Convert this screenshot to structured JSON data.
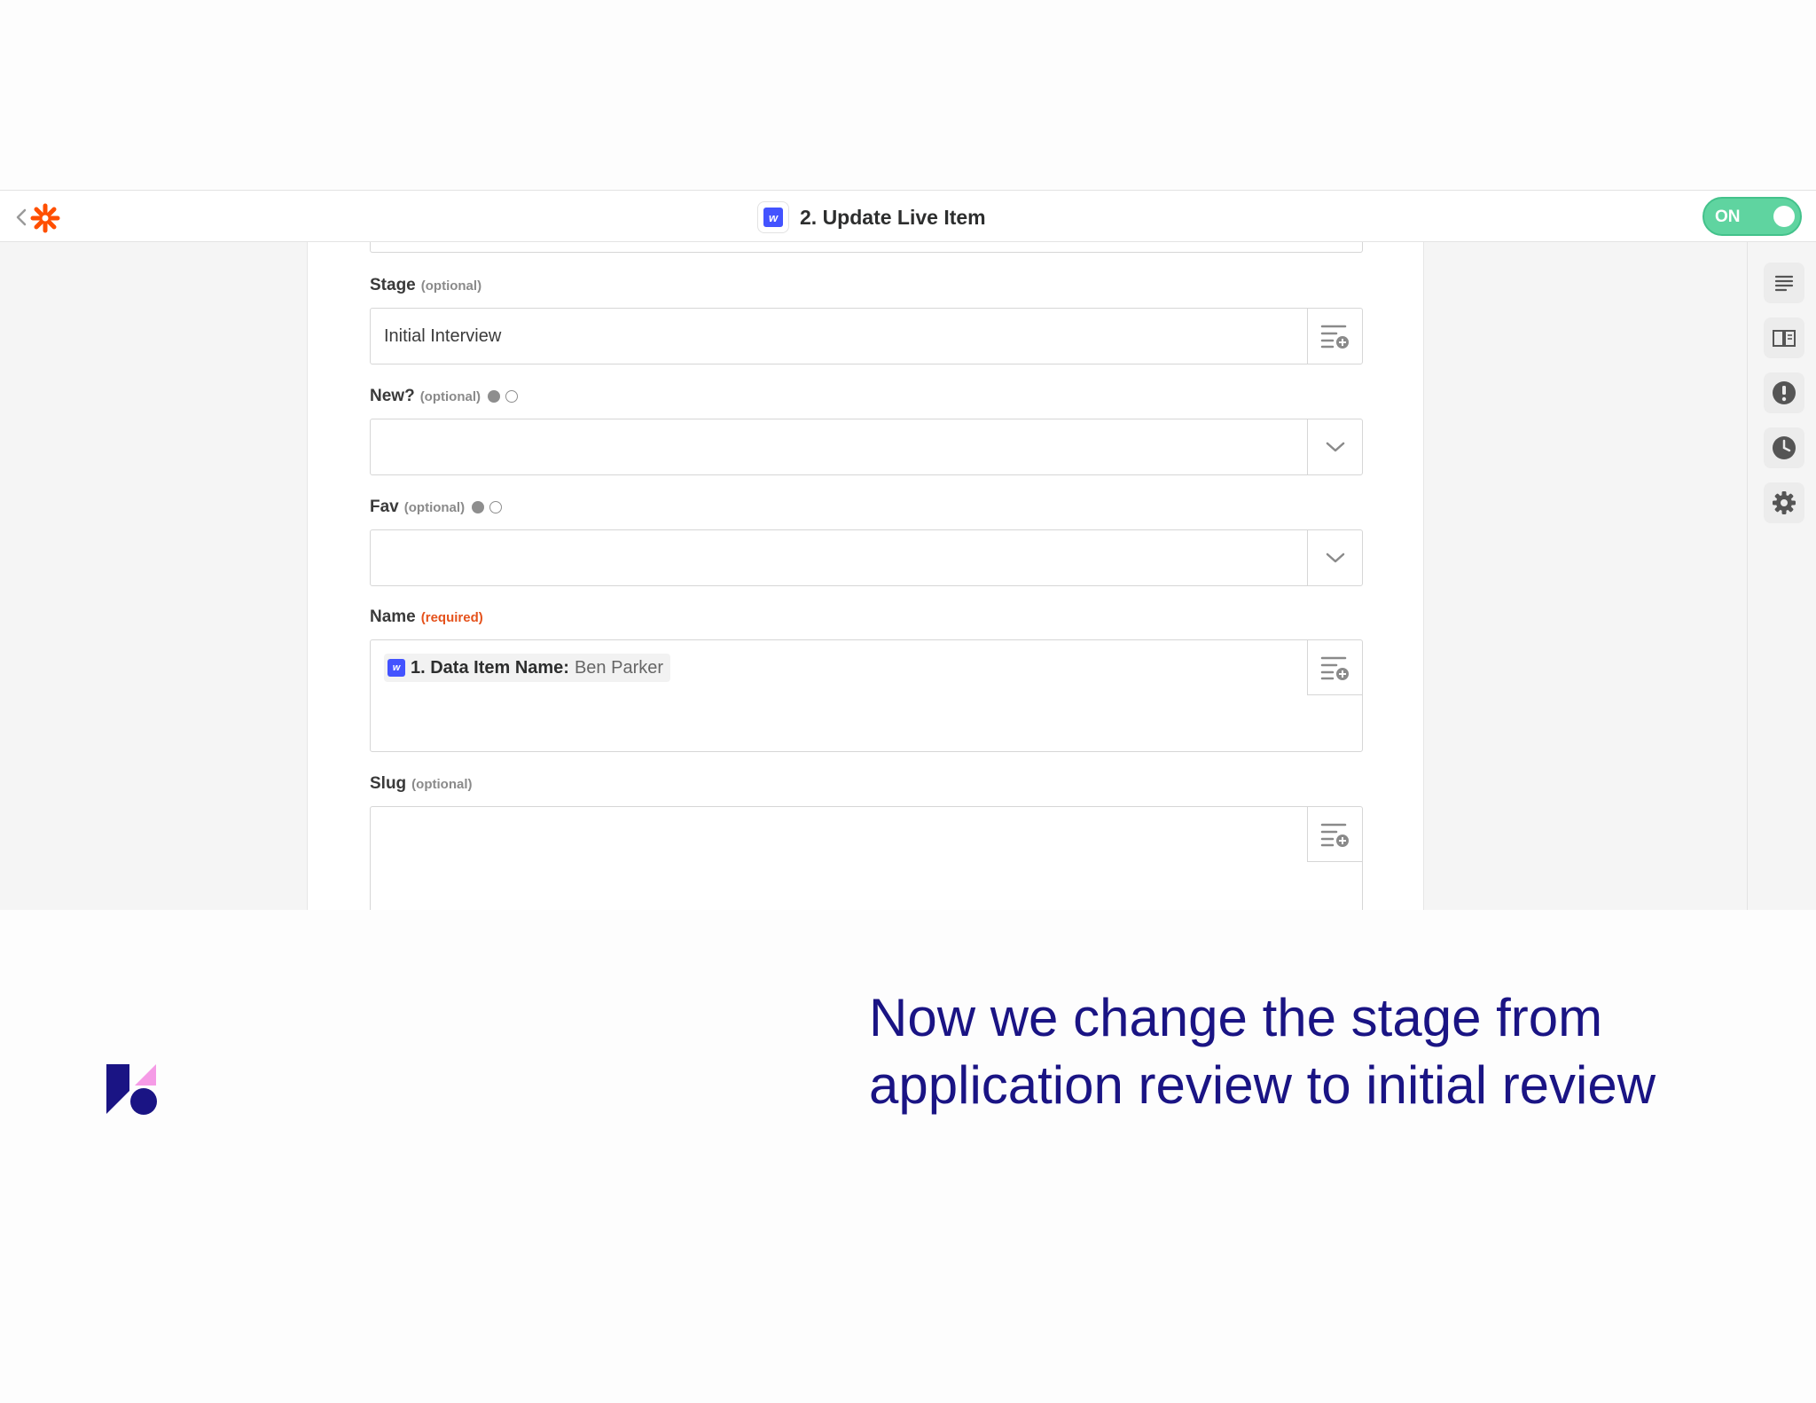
{
  "header": {
    "title": "2. Update Live Item",
    "app_badge_letter": "w",
    "toggle_label": "ON"
  },
  "form": {
    "stage": {
      "label": "Stage",
      "qualifier": "(optional)",
      "value": "Initial Interview"
    },
    "new": {
      "label": "New?",
      "qualifier": "(optional)",
      "value": ""
    },
    "fav": {
      "label": "Fav",
      "qualifier": "(optional)",
      "value": ""
    },
    "name": {
      "label": "Name",
      "qualifier": "(required)",
      "token_badge_letter": "w",
      "token_key": "1. Data Item Name:",
      "token_value": "Ben Parker"
    },
    "slug": {
      "label": "Slug",
      "qualifier": "(optional)",
      "value": ""
    }
  },
  "right_rail": [
    "list-icon",
    "book-icon",
    "alert-icon",
    "clock-icon",
    "gear-icon"
  ],
  "colors": {
    "accent_orange": "#ff4f00",
    "toggle_green": "#5fd4a0",
    "webflow_blue": "#4353ff",
    "required_red": "#e5521c",
    "caption_navy": "#1a1484"
  },
  "caption": {
    "text": "Now we change the stage from application review to initial review"
  }
}
